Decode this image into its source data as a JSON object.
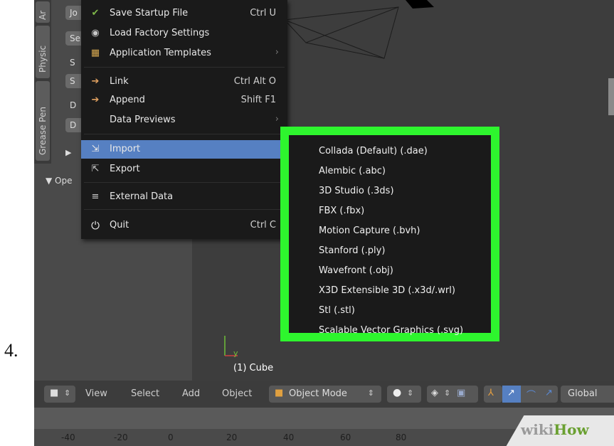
{
  "step_number": "4.",
  "left_panel": {
    "tabs": [
      "Physic",
      "Grease Pen"
    ],
    "buttons": [
      "Jo",
      "Se",
      "S",
      "S",
      "D",
      "D"
    ],
    "operator_label": "▼ Ope"
  },
  "file_menu": {
    "items": [
      {
        "icon": "save-startup-icon",
        "label": "Save Startup File",
        "shortcut": "Ctrl U"
      },
      {
        "icon": "factory-settings-icon",
        "label": "Load Factory Settings",
        "shortcut": ""
      },
      {
        "icon": "templates-icon",
        "label": "Application Templates",
        "shortcut": "›"
      },
      {
        "icon": "link-icon",
        "label": "Link",
        "shortcut": "Ctrl Alt O"
      },
      {
        "icon": "append-icon",
        "label": "Append",
        "shortcut": "Shift F1"
      },
      {
        "icon": "",
        "label": "Data Previews",
        "shortcut": "›"
      },
      {
        "icon": "import-icon",
        "label": "Import",
        "shortcut": ""
      },
      {
        "icon": "export-icon",
        "label": "Export",
        "shortcut": ""
      },
      {
        "icon": "external-data-icon",
        "label": "External Data",
        "shortcut": ""
      },
      {
        "icon": "quit-icon",
        "label": "Quit",
        "shortcut": "Ctrl C"
      }
    ]
  },
  "import_submenu": {
    "items": [
      "Collada (Default) (.dae)",
      "Alembic (.abc)",
      "3D Studio (.3ds)",
      "FBX (.fbx)",
      "Motion Capture (.bvh)",
      "Stanford (.ply)",
      "Wavefront (.obj)",
      "X3D Extensible 3D (.x3d/.wrl)",
      "Stl (.stl)",
      "Scalable Vector Graphics (.svg)"
    ],
    "highlight_color": "#2ef52e"
  },
  "viewport": {
    "object_label": "(1) Cube",
    "axis_label": "y"
  },
  "header": {
    "view": "View",
    "select": "Select",
    "add": "Add",
    "object": "Object",
    "mode": "Object Mode",
    "orientation": "Global"
  },
  "timeline": {
    "ticks": [
      "-40",
      "-20",
      "0",
      "20",
      "40",
      "60",
      "80"
    ]
  },
  "watermark": {
    "wiki": "wiki",
    "how": "How"
  },
  "colors": {
    "menu_highlight": "#5680c2",
    "menu_bg": "#1a1a1a",
    "accent_green": "#2ef52e"
  }
}
